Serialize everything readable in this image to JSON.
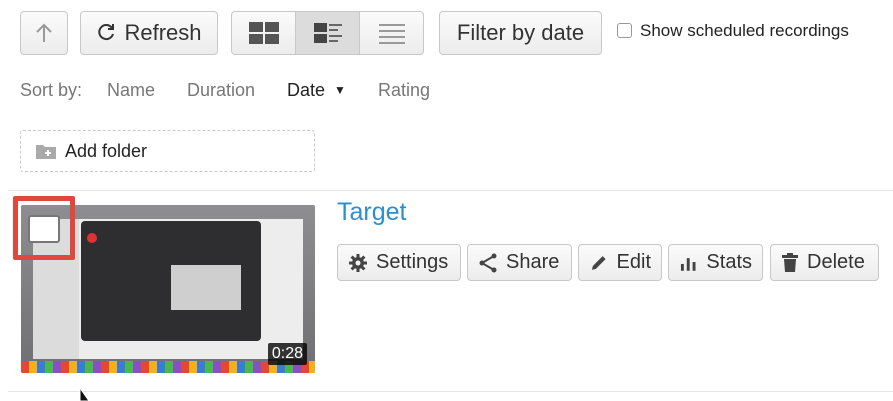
{
  "toolbar": {
    "refresh_label": "Refresh",
    "filter_label": "Filter by date",
    "scheduled_label": "Show scheduled recordings",
    "scheduled_checked": false
  },
  "sort": {
    "prefix": "Sort by:",
    "options": [
      "Name",
      "Duration",
      "Date",
      "Rating"
    ],
    "active": "Date",
    "active_indicator": "▼"
  },
  "folder": {
    "add_label": "Add folder"
  },
  "recording": {
    "title": "Target",
    "duration": "0:28",
    "actions": [
      "Settings",
      "Share",
      "Edit",
      "Stats",
      "Delete"
    ]
  },
  "colors": {
    "title": "#2a8fd0",
    "highlight": "#e0473d",
    "text": "#333333",
    "muted": "#777777"
  },
  "icons": [
    "up-arrow-icon",
    "refresh-icon",
    "grid-view-icon",
    "list-detail-view-icon",
    "list-compact-view-icon",
    "folder-add-icon",
    "gear-icon",
    "share-icon",
    "pencil-icon",
    "bar-chart-icon",
    "trash-icon",
    "mouse-cursor-icon"
  ]
}
